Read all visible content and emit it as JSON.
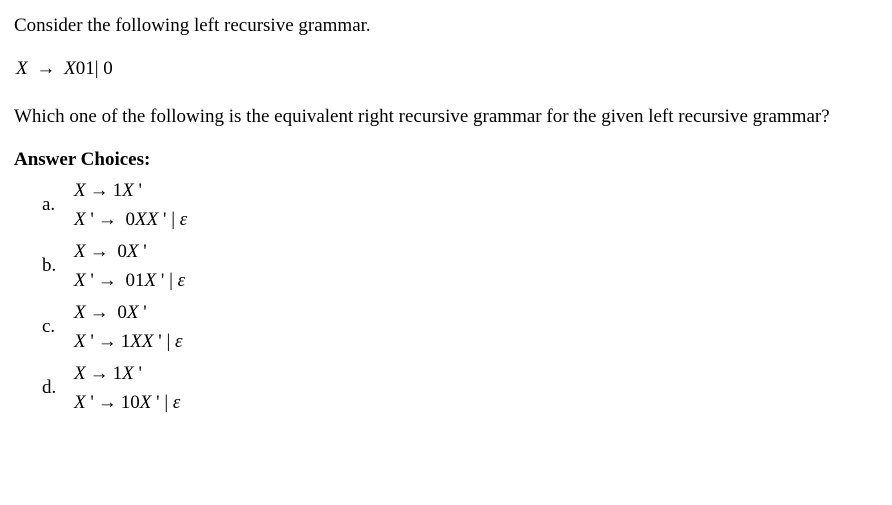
{
  "intro": "Consider the following left recursive grammar.",
  "grammar": {
    "lhs": "X",
    "rhs": "X01 | 0"
  },
  "question": "Which one of the following is the equivalent right recursive grammar for the given left recursive grammar?",
  "answer_heading": "Answer Choices:",
  "choices": [
    {
      "label": "a.",
      "line1": {
        "lhs": "X",
        "rhs": "1X'"
      },
      "line2": {
        "lhs": "X'",
        "rhs": "0XX' | ε"
      }
    },
    {
      "label": "b.",
      "line1": {
        "lhs": "X",
        "rhs": "0X'"
      },
      "line2": {
        "lhs": "X'",
        "rhs": "01X' | ε"
      }
    },
    {
      "label": "c.",
      "line1": {
        "lhs": "X",
        "rhs": "0X'"
      },
      "line2": {
        "lhs": "X'",
        "rhs": "1XX' | ε"
      }
    },
    {
      "label": "d.",
      "line1": {
        "lhs": "X",
        "rhs": "1X'"
      },
      "line2": {
        "lhs": "X'",
        "rhs": "10X' | ε"
      }
    }
  ]
}
